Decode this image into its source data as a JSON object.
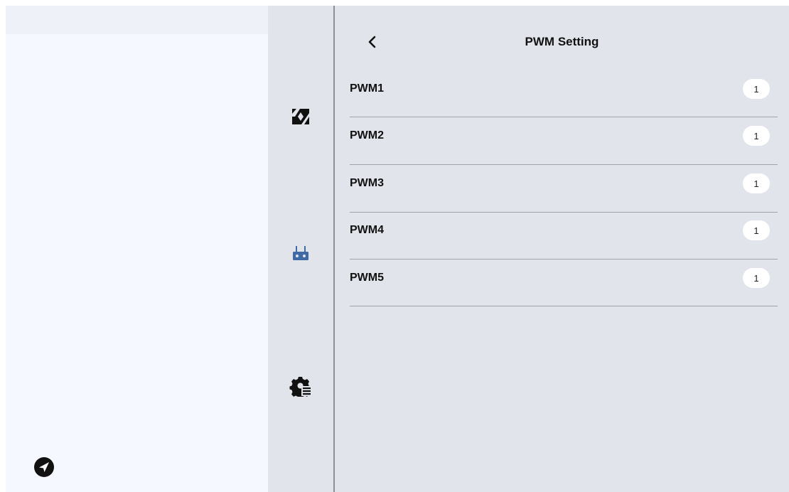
{
  "header": {
    "title": "PWM Setting",
    "back_icon": "chevron-left-icon"
  },
  "rail": {
    "icons": [
      "camera-aperture-icon",
      "remote-controller-icon",
      "settings-list-icon"
    ],
    "active_color": "#3f6aa5"
  },
  "sidebar": {
    "send_icon": "send-icon"
  },
  "pwm_rows": [
    {
      "label": "PWM1",
      "value": "1"
    },
    {
      "label": "PWM2",
      "value": "1"
    },
    {
      "label": "PWM3",
      "value": "1"
    },
    {
      "label": "PWM4",
      "value": "1"
    },
    {
      "label": "PWM5",
      "value": "1"
    }
  ]
}
